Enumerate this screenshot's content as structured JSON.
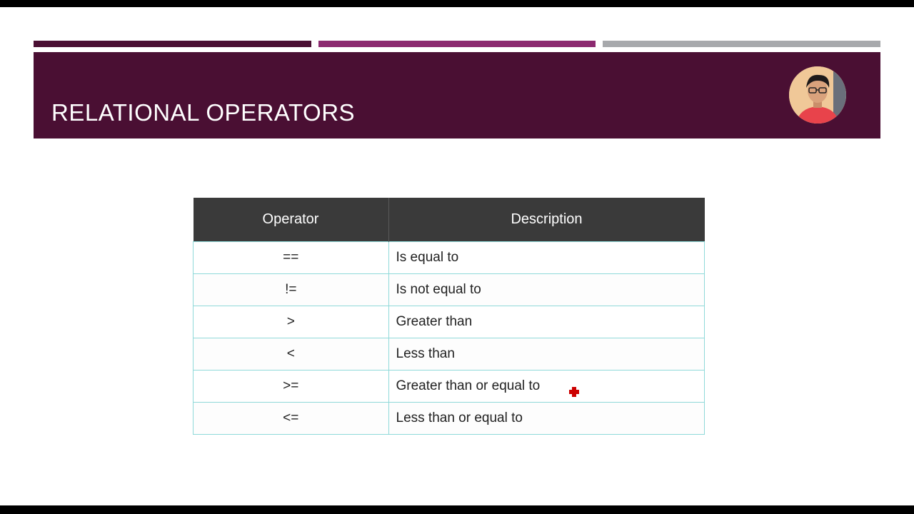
{
  "slide": {
    "title": "RELATIONAL OPERATORS",
    "accent_colors": {
      "bar_left": "#4a0f33",
      "bar_middle": "#8c2a70",
      "bar_right": "#a7a9ac",
      "title_band": "#4a0f33",
      "table_header": "#3a3a3a",
      "table_border": "#8fd9d9"
    },
    "presenter_icon": "presenter-avatar-icon"
  },
  "table": {
    "headers": [
      "Operator",
      "Description"
    ],
    "rows": [
      {
        "operator": "==",
        "description": "Is equal to"
      },
      {
        "operator": "!=",
        "description": "Is not equal to"
      },
      {
        "operator": ">",
        "description": "Greater than"
      },
      {
        "operator": "<",
        "description": "Less than"
      },
      {
        "operator": ">=",
        "description": "Greater than or equal to"
      },
      {
        "operator": "<=",
        "description": "Less than or equal to"
      }
    ]
  },
  "pointer": {
    "icon": "laser-pointer-icon",
    "color": "#cc0000"
  }
}
